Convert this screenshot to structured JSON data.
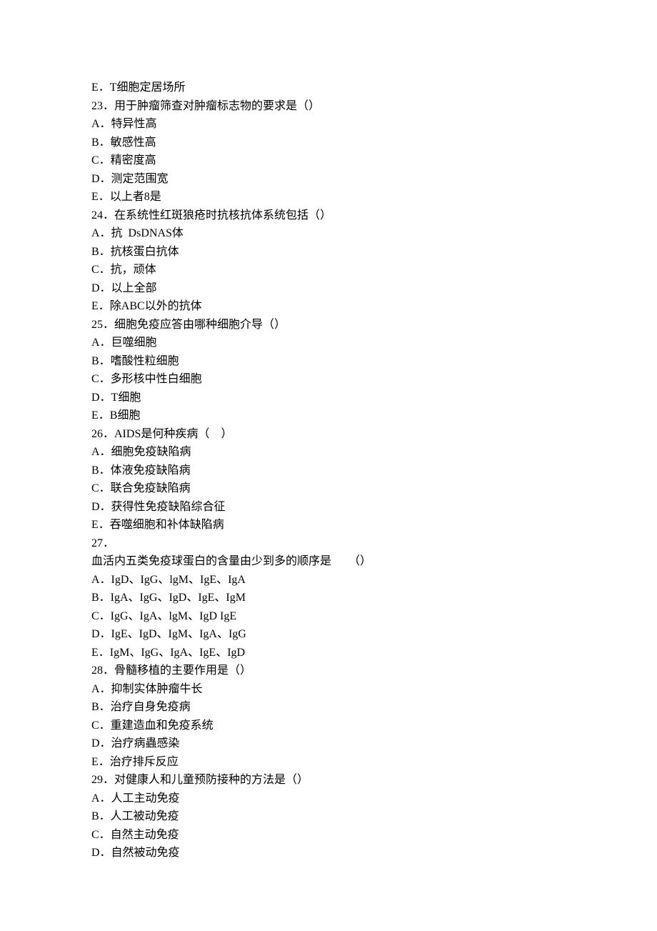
{
  "lines": [
    "E．T细胞定居场所",
    "23．用于肿瘤筛查对肿瘤标志物的要求是（）",
    "A．特异性高",
    "B．敏感性高",
    "C．精密度高",
    "D．测定范围宽",
    "E．以上者8是",
    "24．在系统性红斑狼疮时抗核抗体系统包括（）",
    "A．抗  DsDNAS体",
    "B．抗核蛋白抗体",
    "C．抗，顽体",
    "D．以上全部",
    "E．除ABC以外的抗体",
    "25．细胞免疫应答由哪种细胞介导（）",
    "A．巨噬细胞",
    "B．嗜酸性粒细胞",
    "C．多形核中性白细胞",
    "D．T细胞",
    "E．B细胞",
    "26．AIDS是何种疾病（　）",
    "A．细胞免疫缺陷病",
    "B．体液免疫缺陷病",
    "C．联合免疫缺陷病",
    "D．获得性免疫缺陷综合征",
    "E．吞噬细胞和补体缺陷病",
    "27．",
    "血活内五类免疫球蛋白的含量由少到多的顺序是　　（）",
    "A．IgD、IgG、lgM、IgE、IgA",
    "B．IgA、IgG、IgD、IgE、IgM",
    "C．IgG、IgA、lgM、IgD IgE",
    "D．IgE、IgD、IgM、IgA、IgG",
    "E．IgM、IgG、IgA、IgE、IgD",
    "28．骨髓移植的主要作用是（）",
    "A．抑制实体肿瘤牛长",
    "B．治疗自身免疫病",
    "C．重建造血和免疫系统",
    "D．治疗病蟲感染",
    "E．治疗排斥反应",
    "29．对健康人和儿童预防接种的方法是（）",
    "A．人工主动免疫",
    "B．人工被动免疫",
    "C．自然主动免疫",
    "D．自然被动免疫"
  ]
}
